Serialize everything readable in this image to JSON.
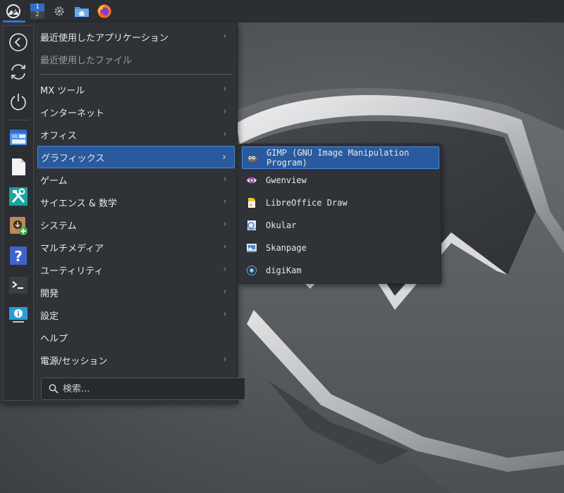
{
  "panel": {
    "pager": {
      "workspace_1": "1",
      "workspace_2": "2"
    }
  },
  "menu": {
    "recent_apps": "最近使用したアプリケーション",
    "recent_files": "最近使用したファイル",
    "categories": [
      {
        "label": "MX ツール"
      },
      {
        "label": "インターネット"
      },
      {
        "label": "オフィス"
      },
      {
        "label": "グラフィックス",
        "selected": true
      },
      {
        "label": "ゲーム"
      },
      {
        "label": "サイエンス & 数学"
      },
      {
        "label": "システム"
      },
      {
        "label": "マルチメディア"
      },
      {
        "label": "ユーティリティ"
      },
      {
        "label": "開発"
      },
      {
        "label": "設定"
      },
      {
        "label": "ヘルプ"
      },
      {
        "label": "電源/セッション"
      }
    ],
    "search_placeholder": "検索..."
  },
  "submenu": {
    "items": [
      {
        "label": "GIMP (GNU Image Manipulation Program)",
        "icon": "gimp-icon",
        "selected": true
      },
      {
        "label": "Gwenview",
        "icon": "gwenview-icon"
      },
      {
        "label": "LibreOffice Draw",
        "icon": "libreoffice-draw-icon"
      },
      {
        "label": "Okular",
        "icon": "okular-icon"
      },
      {
        "label": "Skanpage",
        "icon": "skanpage-icon"
      },
      {
        "label": "digiKam",
        "icon": "digikam-icon"
      }
    ]
  },
  "colors": {
    "accent": "#3d7bd9",
    "selection": "#2a5a9e",
    "menu_bg": "#2f3237",
    "panel_bg": "#2b2e33"
  }
}
